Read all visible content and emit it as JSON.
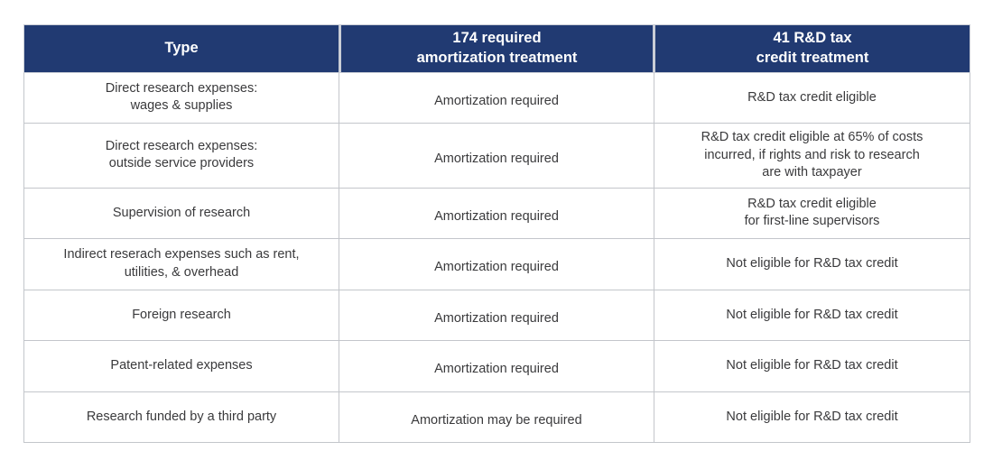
{
  "table": {
    "headers": [
      {
        "id": "type",
        "lines": [
          "Type"
        ]
      },
      {
        "id": "amort",
        "lines": [
          "174 required",
          "amortization treatment"
        ]
      },
      {
        "id": "credit",
        "lines": [
          "41 R&D tax",
          "credit treatment"
        ]
      }
    ],
    "rows": [
      {
        "type": [
          "Direct research expenses:",
          "wages & supplies"
        ],
        "amort": [
          "Amortization required"
        ],
        "credit": [
          "R&D tax credit eligible"
        ]
      },
      {
        "type": [
          "Direct research expenses:",
          "outside service providers"
        ],
        "amort": [
          "Amortization required"
        ],
        "credit": [
          "R&D tax credit eligible at 65% of costs",
          "incurred, if rights and risk to research",
          "are with taxpayer"
        ]
      },
      {
        "type": [
          "Supervision of research"
        ],
        "amort": [
          "Amortization required"
        ],
        "credit": [
          "R&D tax credit eligible",
          "for first-line supervisors"
        ]
      },
      {
        "type": [
          "Indirect reserach expenses such as rent,",
          "utilities, & overhead"
        ],
        "amort": [
          "Amortization required"
        ],
        "credit": [
          "Not eligible for R&D tax credit"
        ]
      },
      {
        "type": [
          "Foreign research"
        ],
        "amort": [
          "Amortization required"
        ],
        "credit": [
          "Not eligible for R&D tax credit"
        ]
      },
      {
        "type": [
          "Patent-related expenses"
        ],
        "amort": [
          "Amortization required"
        ],
        "credit": [
          "Not eligible for R&D tax credit"
        ]
      },
      {
        "type": [
          "Research funded by a third party"
        ],
        "amort": [
          "Amortization may be required"
        ],
        "credit": [
          "Not eligible for R&D tax credit"
        ]
      }
    ]
  },
  "colors": {
    "header_background": "#213a72",
    "header_text": "#ffffff",
    "body_text": "#3a3a3c",
    "grid_line": "#c3c6cb",
    "header_border": "#c9cdd6",
    "page_background": "#ffffff"
  }
}
